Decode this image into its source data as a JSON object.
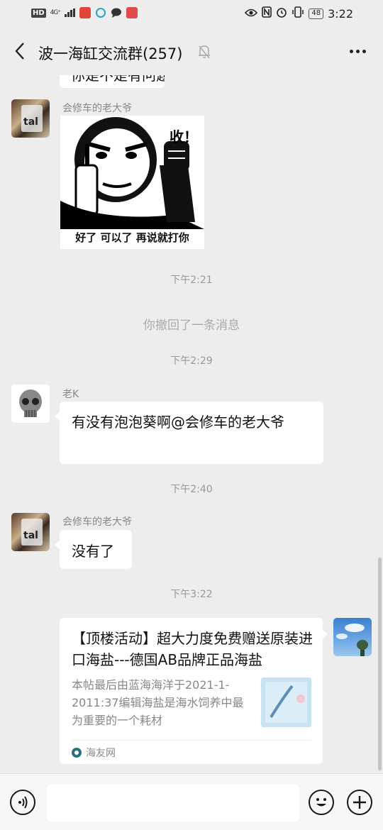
{
  "status_bar": {
    "hd": "HD",
    "network": "4G⁺",
    "battery": "48",
    "time": "3:22"
  },
  "header": {
    "title": "波一海缸交流群(257)"
  },
  "messages": {
    "partial_text": "你是不是有问题",
    "m1": {
      "sender": "会修车的老大爷",
      "sticker_word": "收！",
      "sticker_caption": "好了 可以了 再说就打你"
    },
    "ts1": "下午2:21",
    "sys1": "你撤回了一条消息",
    "ts2": "下午2:29",
    "m2": {
      "sender": "老K",
      "text": "有没有泡泡葵啊@会修车的老大爷"
    },
    "ts3": "下午2:40",
    "m3": {
      "sender": "会修车的老大爷",
      "text": "没有了"
    },
    "ts4": "下午3:22",
    "card": {
      "title": "【顶楼活动】超大力度免费赠送原装进口海盐---德国AB品牌正品海盐",
      "desc": "本帖最后由蓝海海洋于2021-1-2011:37编辑海盐是海水饲养中最为重要的一个耗材",
      "source": "海友网"
    }
  },
  "input": {
    "value": ""
  }
}
